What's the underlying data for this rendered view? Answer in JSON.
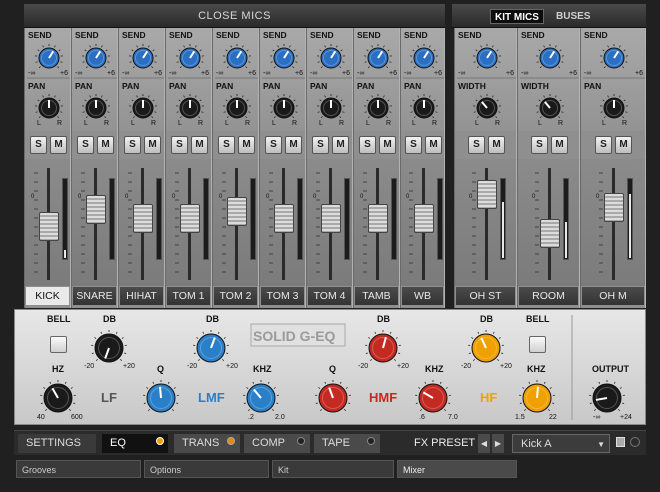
{
  "header": {
    "close_mics": "CLOSE MICS",
    "kit_mics_tab": "KIT MICS",
    "buses_tab": "BUSES"
  },
  "channels": [
    {
      "name": "KICK",
      "mode": "pan",
      "selected": true
    },
    {
      "name": "SNARE",
      "mode": "pan",
      "selected": false
    },
    {
      "name": "HIHAT",
      "mode": "pan",
      "selected": false
    },
    {
      "name": "TOM 1",
      "mode": "pan",
      "selected": false
    },
    {
      "name": "TOM 2",
      "mode": "pan",
      "selected": false
    },
    {
      "name": "TOM 3",
      "mode": "pan",
      "selected": false
    },
    {
      "name": "TOM 4",
      "mode": "pan",
      "selected": false
    },
    {
      "name": "TAMB",
      "mode": "pan",
      "selected": false
    },
    {
      "name": "WB",
      "mode": "pan",
      "selected": false
    },
    {
      "name": "OH ST",
      "mode": "width",
      "selected": false
    },
    {
      "name": "ROOM",
      "mode": "width",
      "selected": false
    },
    {
      "name": "OH M",
      "mode": "pan",
      "selected": false
    }
  ],
  "labels": {
    "send": "SEND",
    "pan": "PAN",
    "width": "WIDTH",
    "send_min": "-∞",
    "send_max": "+6",
    "pan_l": "L",
    "pan_r": "R",
    "solo": "S",
    "mute": "M",
    "fader_zero": "0"
  },
  "eq": {
    "brand": "SOLID G-EQ",
    "bell": "BELL",
    "db": "DB",
    "hz": "HZ",
    "q": "Q",
    "khz": "KHZ",
    "output": "OUTPUT",
    "db_min": "-20",
    "db_max": "+20",
    "lf": "LF",
    "lmf": "LMF",
    "hmf": "HMF",
    "hf": "HF",
    "lf_hz_min": "40",
    "lf_hz_max": "600",
    "lmf_khz_min": ".2",
    "lmf_khz_max": "2.0",
    "hmf_khz_min": ".6",
    "hmf_khz_max": "7.0",
    "hf_khz_min": "1.5",
    "hf_khz_max": "22",
    "out_min": "-∞",
    "out_max": "+24",
    "colors": {
      "black": "#1a1a1a",
      "blue": "#2a7fc9",
      "red": "#c42a22",
      "orange": "#f0a000"
    }
  },
  "fx": {
    "settings": "SETTINGS",
    "eq": "EQ",
    "trans": "TRANS",
    "comp": "COMP",
    "tape": "TAPE",
    "preset_label": "FX PRESET",
    "preset_value": "Kick A"
  },
  "status": {
    "grooves": "Grooves",
    "options": "Options",
    "kit": "Kit",
    "mixer": "Mixer"
  }
}
